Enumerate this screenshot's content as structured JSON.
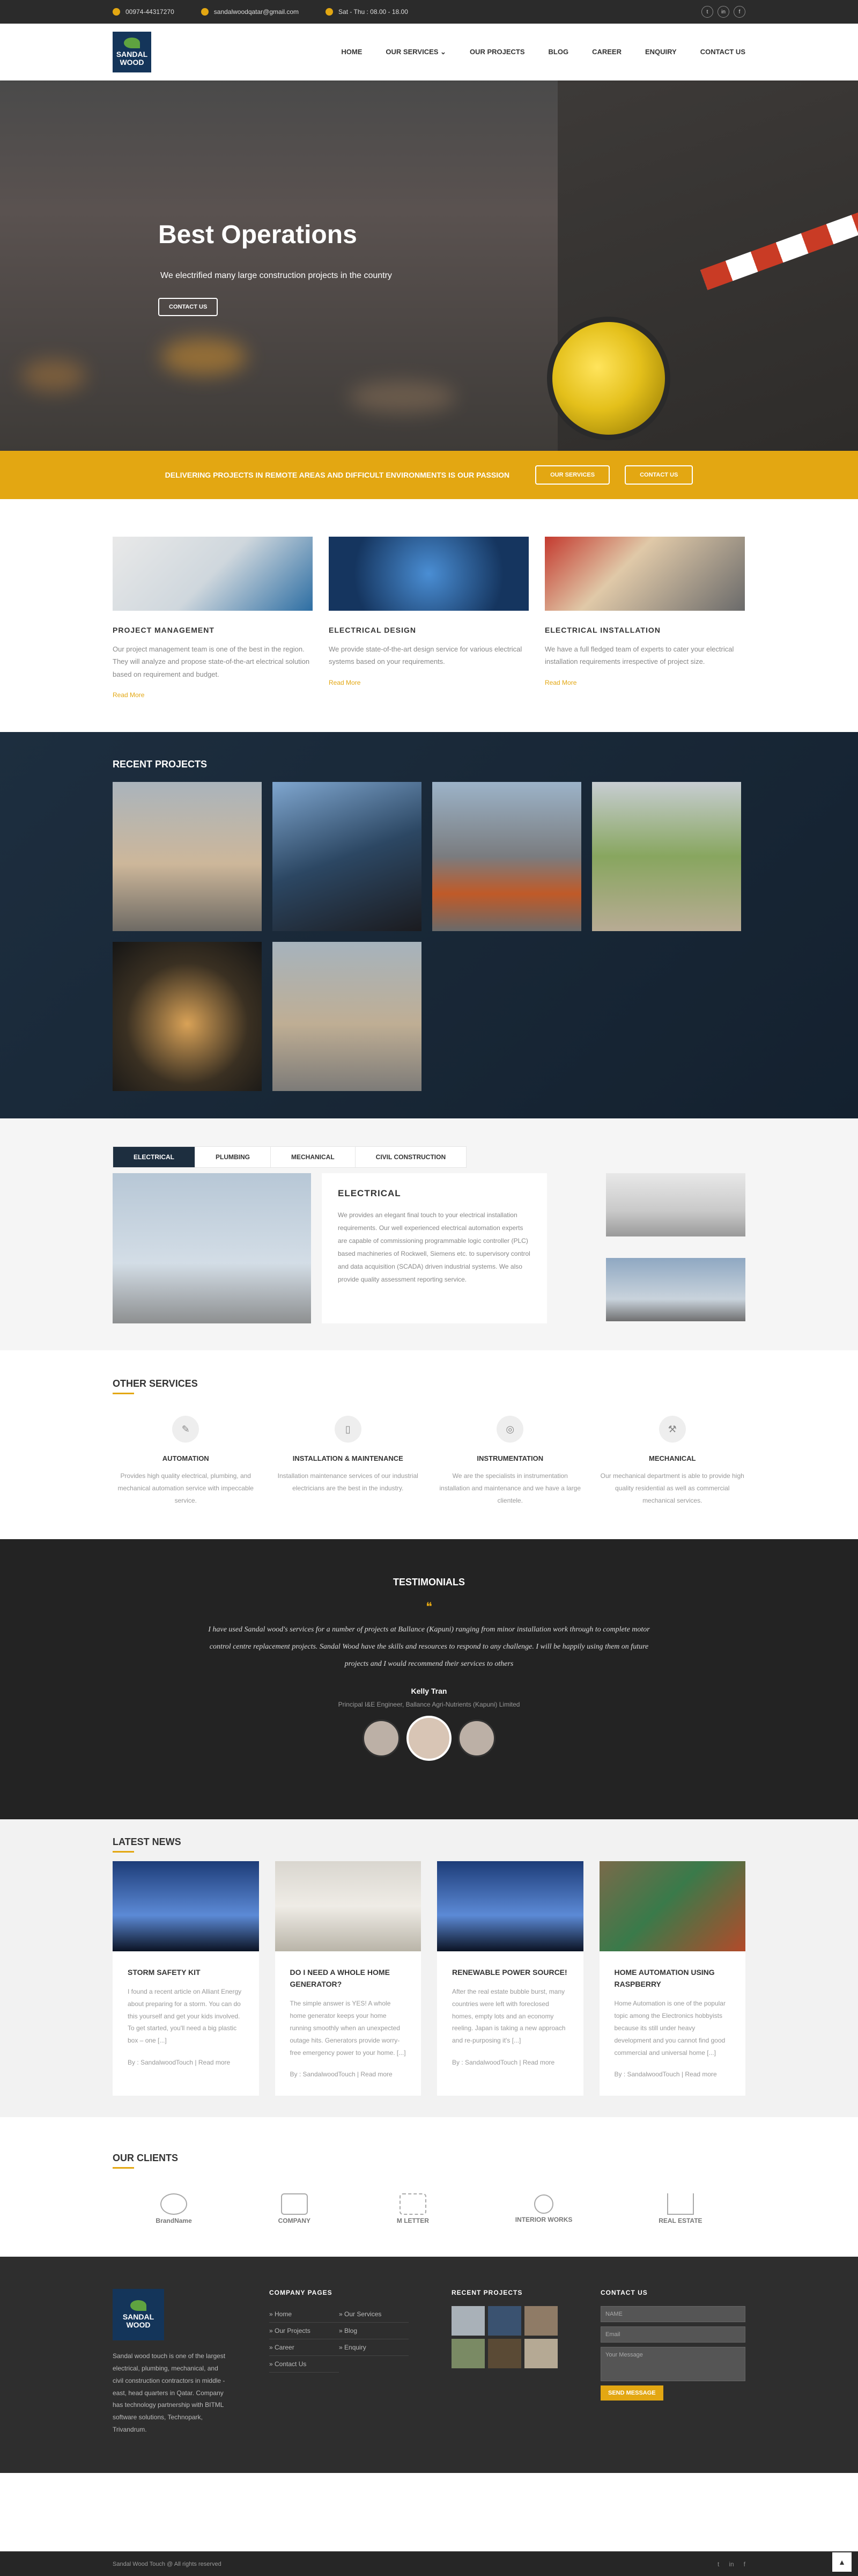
{
  "topbar": {
    "phone": "00974-44317270",
    "email": "sandalwoodqatar@gmail.com",
    "hours": "Sat - Thu : 08.00 - 18.00",
    "social": [
      "t",
      "in",
      "f"
    ]
  },
  "header": {
    "logo_line1": "SANDAL",
    "logo_line2": "WOOD",
    "nav": [
      "HOME",
      "OUR SERVICES ⌄",
      "OUR PROJECTS",
      "BLOG",
      "CAREER",
      "ENQUIRY",
      "CONTACT US"
    ]
  },
  "hero": {
    "title": "Best Operations",
    "subtitle": "We electrified many large construction projects in the country",
    "button": "CONTACT US"
  },
  "banner": {
    "message": "DELIVERING PROJECTS IN REMOTE AREAS AND DIFFICULT ENVIRONMENTS IS OUR PASSION",
    "btn1": "OUR SERVICES",
    "btn2": "CONTACT US"
  },
  "services": [
    {
      "title": "PROJECT MANAGEMENT",
      "text": "Our project management team is one of the best in the region. They will analyze and propose state-of-the-art electrical solution based on requirement and budget.",
      "link": "Read More"
    },
    {
      "title": "ELECTRICAL DESIGN",
      "text": "We provide state-of-the-art design service for various electrical systems based on your requirements.",
      "link": "Read More"
    },
    {
      "title": "ELECTRICAL INSTALLATION",
      "text": "We have a full fledged team of experts to cater your electrical installation requirements irrespective of project size.",
      "link": "Read More"
    }
  ],
  "projects": {
    "title": "RECENT PROJECTS"
  },
  "tabs": {
    "labels": [
      "ELECTRICAL",
      "PLUMBING",
      "MECHANICAL",
      "CIVIL CONSTRUCTION"
    ],
    "content_title": "ELECTRICAL",
    "content_text": "We provides an elegant final touch to your electrical installation requirements. Our well experienced electrical automation experts are capable of commissioning programmable logic controller (PLC) based machineries of Rockwell, Siemens etc. to supervisory control and data acquisition (SCADA) driven industrial systems. We also provide quality assessment reporting service."
  },
  "other_services": {
    "title": "OTHER SERVICES",
    "items": [
      {
        "title": "AUTOMATION",
        "text": "Provides high quality electrical, plumbing, and mechanical automation service with impeccable service."
      },
      {
        "title": "INSTALLATION & MAINTENANCE",
        "text": "Installation maintenance services of our industrial electricians are the best in the industry."
      },
      {
        "title": "INSTRUMENTATION",
        "text": "We are the specialists in instrumentation installation and maintenance and we have a large clientele."
      },
      {
        "title": "MECHANICAL",
        "text": "Our mechanical department is able to provide high quality residential as well as commercial mechanical services."
      }
    ]
  },
  "testimonials": {
    "title": "TESTIMONIALS",
    "quote": "I have used Sandal wood's services for a number of projects at Ballance (Kapuni) ranging from minor installation work through to complete motor control centre replacement projects. Sandal Wood have the skills and resources to respond to any challenge. I will be happily using them on future projects and I would recommend their services to others",
    "name": "Kelly Tran",
    "role": "Principal I&E Engineer, Ballance Agri-Nutrients (Kapuni) Limited"
  },
  "news": {
    "title": "LATEST NEWS",
    "items": [
      {
        "title": "STORM SAFETY KIT",
        "text": "I found a recent article on Alliant Energy about preparing for a storm. You can do this yourself and get your kids involved. To get started, you'll need a big plastic box – one [...]",
        "meta": "By : SandalwoodTouch | Read more"
      },
      {
        "title": "DO I NEED A WHOLE HOME GENERATOR?",
        "text": "The simple answer is YES! A whole home generator keeps your home running smoothly when an unexpected outage hits. Generators provide worry-free emergency power to your home. [...]",
        "meta": "By : SandalwoodTouch | Read more"
      },
      {
        "title": "RENEWABLE POWER SOURCE!",
        "text": "After the real estate bubble burst, many countries were left with foreclosed homes, empty lots and an economy reeling. Japan is taking a new approach and re-purposing it's [...]",
        "meta": "By : SandalwoodTouch | Read more"
      },
      {
        "title": "HOME AUTOMATION USING RASPBERRY",
        "text": "Home Automation is one of the popular topic among the Electronics hobbyists because its still under heavy development and you cannot find good commercial and universal home [...]",
        "meta": "By : SandalwoodTouch | Read more"
      }
    ]
  },
  "clients": {
    "title": "OUR CLIENTS",
    "items": [
      "BrandName",
      "COMPANY",
      "M LETTER",
      "INTERIOR WORKS",
      "REAL ESTATE"
    ]
  },
  "footer": {
    "about": "Sandal wood touch is one of the largest electrical, plumbing, mechanical, and civil construction contractors in middle - east, head quarters in Qatar. Company has technology partnership with BITML software solutions, Technopark, Trivandrum.",
    "pages_title": "COMPANY PAGES",
    "pages": [
      "Home",
      "Our Services",
      "Our Projects",
      "Blog",
      "Career",
      "Enquiry",
      "Contact Us"
    ],
    "recent_title": "RECENT PROJECTS",
    "contact_title": "CONTACT US",
    "name_placeholder": "NAME",
    "email_placeholder": "Email",
    "message_placeholder": "Your Message",
    "send": "SEND MESSAGE",
    "copyright": "Sandal Wood Touch @ All rights reserved",
    "social": [
      "t",
      "in",
      "f"
    ],
    "backtop": "▲"
  },
  "colors": {
    "accent": "#e3a712",
    "navy": "#1d2e3f",
    "dark": "#232323"
  }
}
